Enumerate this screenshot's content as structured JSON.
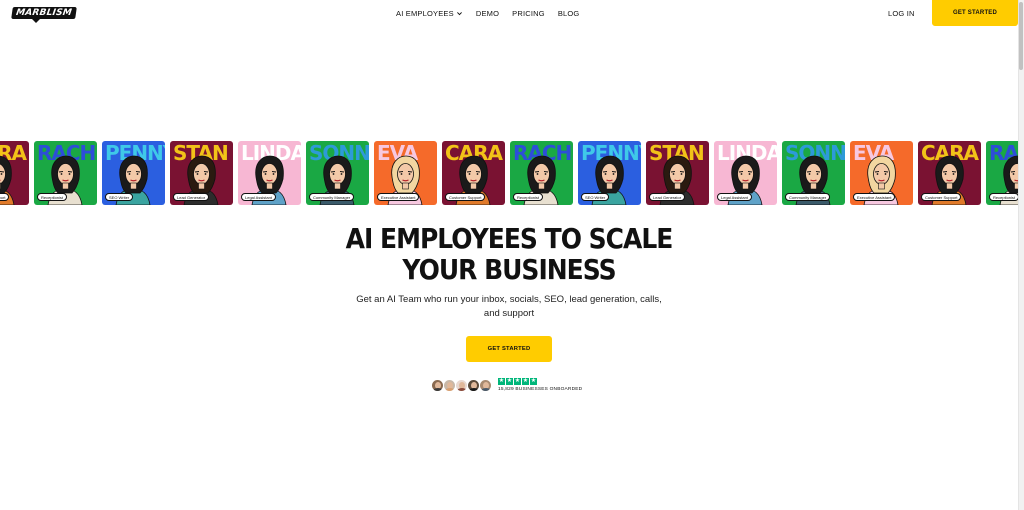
{
  "nav": {
    "logo": "MARBLISM",
    "items": [
      {
        "label": "AI EMPLOYEES",
        "has_dropdown": true
      },
      {
        "label": "DEMO",
        "has_dropdown": false
      },
      {
        "label": "PRICING",
        "has_dropdown": false
      },
      {
        "label": "BLOG",
        "has_dropdown": false
      }
    ],
    "login": "LOG IN",
    "cta": "GET STARTED"
  },
  "cards": [
    {
      "name": "RACHEL",
      "label": "Receptionist",
      "bg": "#1aa844",
      "fg": "#2d4ed8",
      "hair": "#1a1a1a",
      "shirt": "#e8e0d0"
    },
    {
      "name": "PENNY",
      "label": "SEO Writer",
      "bg": "#2b5fe0",
      "fg": "#3fc9e8",
      "hair": "#1a1a1a",
      "shirt": "#3aa4a0"
    },
    {
      "name": "STAN",
      "label": "Lead Generator",
      "bg": "#7a1232",
      "fg": "#f2c318",
      "hair": "#2a1a10",
      "shirt": "#2c2c2c"
    },
    {
      "name": "LINDA",
      "label": "Legal Assistant",
      "bg": "#f7b7d3",
      "fg": "#ffffff",
      "hair": "#1a1a1a",
      "shirt": "#5fa2c8"
    },
    {
      "name": "SONNY",
      "label": "Community Manager",
      "bg": "#1aa844",
      "fg": "#2d9ad8",
      "hair": "#1a1a1a",
      "shirt": "#3a5a6a"
    },
    {
      "name": "EVA",
      "label": "Executive Assistant",
      "bg": "#f56a2a",
      "fg": "#f7c8e0",
      "hair": "#f2d6a0",
      "shirt": "#f7c8e0"
    },
    {
      "name": "CARA",
      "label": "Customer Support",
      "bg": "#7a1232",
      "fg": "#f2c318",
      "hair": "#1a1a1a",
      "shirt": "#e07a2a"
    }
  ],
  "hero": {
    "headline_line1": "AI EMPLOYEES TO SCALE",
    "headline_line2": "YOUR BUSINESS",
    "sub_line1": "Get an AI Team who run your inbox, socials, SEO, lead generation, calls,",
    "sub_line2": "and support",
    "cta": "GET STARTED"
  },
  "social_proof": {
    "rating_stars": 5,
    "text": "15,829 BUSINESSES ONBOARDED",
    "star_color": "#00b67a"
  },
  "colors": {
    "accent": "#ffcc00"
  }
}
